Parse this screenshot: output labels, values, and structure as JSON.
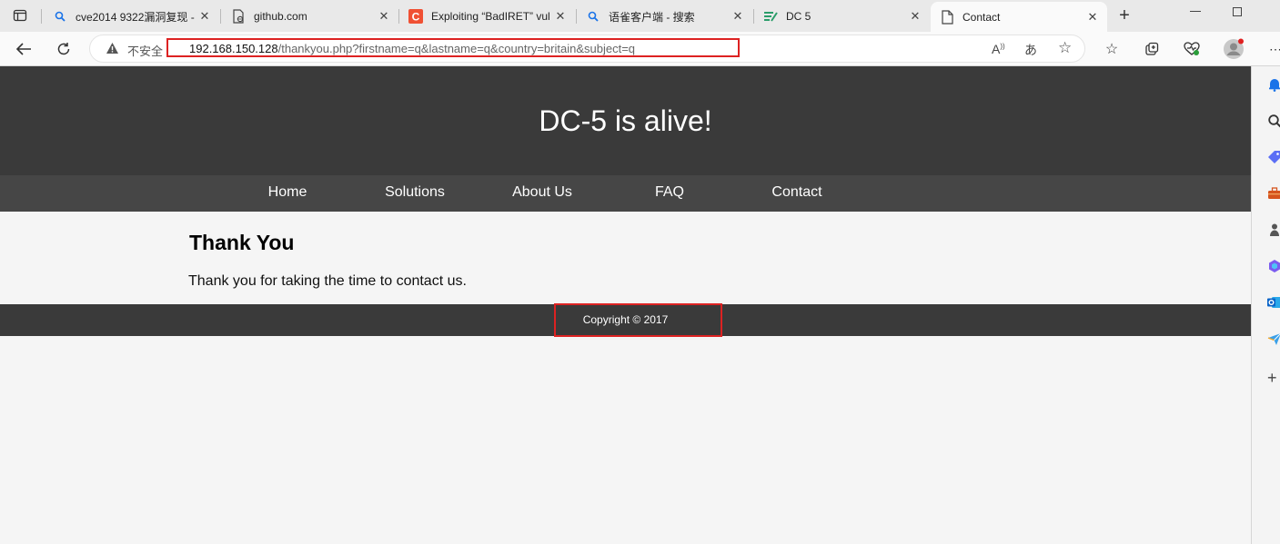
{
  "browser": {
    "tabs": [
      {
        "title": "cve2014 9322漏洞复现 -",
        "icon": "search-icon"
      },
      {
        "title": "github.com",
        "icon": "page-link-icon"
      },
      {
        "title": "Exploiting “BadIRET” vul",
        "icon": "c-logo-icon"
      },
      {
        "title": "语雀客户端 - 搜索",
        "icon": "search-icon"
      },
      {
        "title": "DC 5",
        "icon": "dc5-logo-icon"
      },
      {
        "title": "Contact",
        "icon": "page-icon",
        "active": true
      }
    ],
    "security_label": "不安全",
    "url_host": "192.168.150.128",
    "url_path": "/thankyou.php?firstname=q&lastname=q&country=britain&subject=q"
  },
  "site": {
    "title": "DC-5 is alive!",
    "nav": [
      "Home",
      "Solutions",
      "About Us",
      "FAQ",
      "Contact"
    ],
    "heading": "Thank You",
    "message": "Thank you for taking the time to contact us.",
    "footer": "Copyright © 2017"
  },
  "colors": {
    "header_bg": "#3a3a3a",
    "nav_bg": "#464646",
    "highlight": "#dd2222"
  }
}
